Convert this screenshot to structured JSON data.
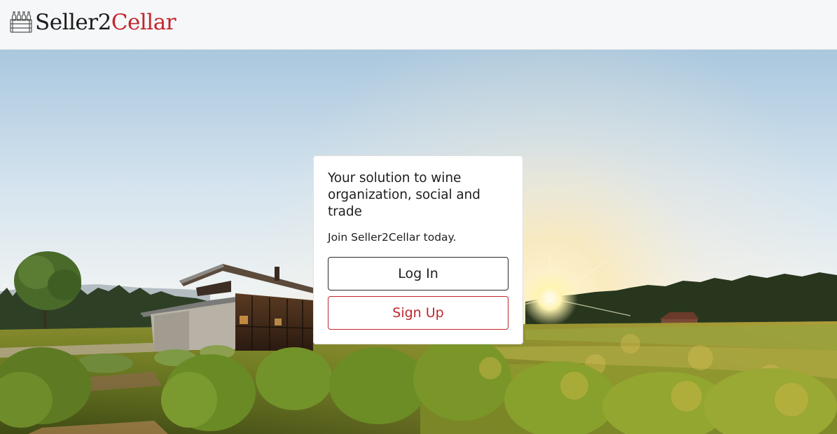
{
  "brand": {
    "part1": "Seller2",
    "part2": "Cellar",
    "logo_icon": "wine-crate-icon"
  },
  "hero": {
    "image": "vineyard-sunset-photo"
  },
  "card": {
    "title": "Your solution to wine organization, social and trade",
    "subtitle": "Join Seller2Cellar today.",
    "login_label": "Log In",
    "signup_label": "Sign Up"
  },
  "colors": {
    "brand_red": "#c1272d",
    "navbar_bg": "#f6f7f9",
    "text_dark": "#1e1e1e"
  }
}
